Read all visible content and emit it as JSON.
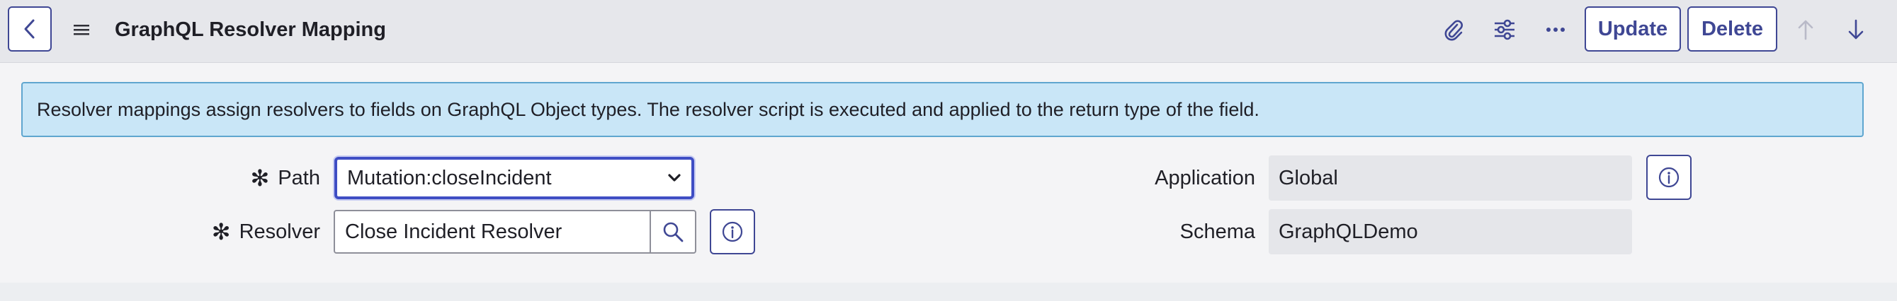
{
  "header": {
    "title": "GraphQL Resolver Mapping",
    "update_label": "Update",
    "delete_label": "Delete",
    "icons": [
      "back-icon",
      "hamburger-icon",
      "paperclip-icon",
      "sliders-icon",
      "more-icon",
      "arrow-up-icon",
      "arrow-down-icon"
    ]
  },
  "banner": {
    "text": "Resolver mappings assign resolvers to fields on GraphQL Object types. The resolver script is executed and applied to the return type of the field."
  },
  "form": {
    "path_label": "Path",
    "path_value": "Mutation:closeIncident",
    "resolver_label": "Resolver",
    "resolver_value": "Close Incident Resolver",
    "application_label": "Application",
    "application_value": "Global",
    "schema_label": "Schema",
    "schema_value": "GraphQLDemo",
    "required_marker": "✻"
  },
  "colors": {
    "accent": "#3f4794",
    "focus": "#3f4ec4",
    "banner_bg": "#c9e6f7",
    "banner_border": "#5fa6cf",
    "header_bg": "#e6e7eb",
    "readonly_bg": "#e5e6ea"
  }
}
